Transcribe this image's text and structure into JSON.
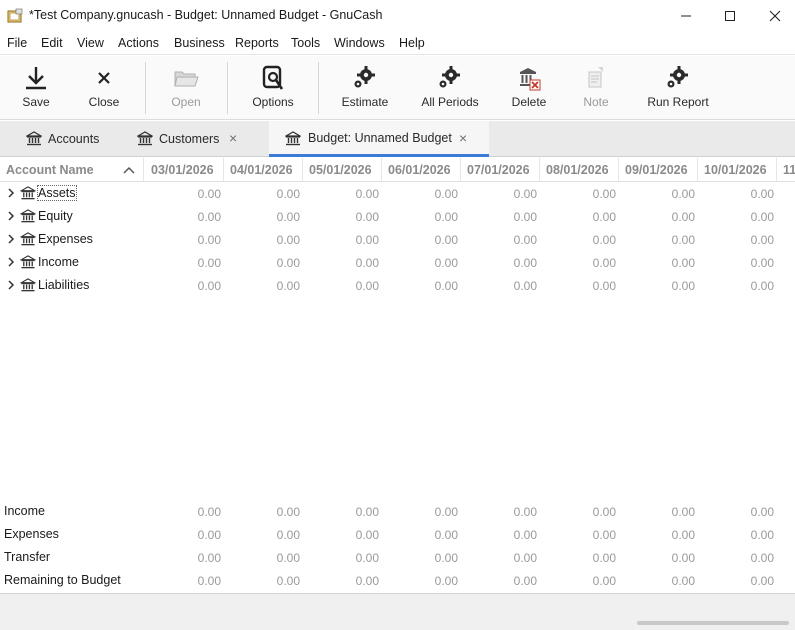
{
  "window": {
    "title": "*Test Company.gnucash - Budget: Unnamed Budget - GnuCash"
  },
  "menu": [
    "File",
    "Edit",
    "View",
    "Actions",
    "Business",
    "Reports",
    "Tools",
    "Windows",
    "Help"
  ],
  "toolbar": {
    "save": "Save",
    "close": "Close",
    "open": "Open",
    "options": "Options",
    "estimate": "Estimate",
    "all_periods": "All Periods",
    "delete": "Delete",
    "note": "Note",
    "run_report": "Run Report"
  },
  "tabs": {
    "accounts": "Accounts",
    "customers": "Customers",
    "budget": "Budget: Unnamed Budget",
    "close_glyph": "×"
  },
  "table": {
    "name_header": "Account Name",
    "periods": [
      "03/01/2026",
      "04/01/2026",
      "05/01/2026",
      "06/01/2026",
      "07/01/2026",
      "08/01/2026",
      "09/01/2026",
      "10/01/2026",
      "11"
    ],
    "accounts": [
      {
        "name": "Assets",
        "values": [
          "0.00",
          "0.00",
          "0.00",
          "0.00",
          "0.00",
          "0.00",
          "0.00",
          "0.00"
        ]
      },
      {
        "name": "Equity",
        "values": [
          "0.00",
          "0.00",
          "0.00",
          "0.00",
          "0.00",
          "0.00",
          "0.00",
          "0.00"
        ]
      },
      {
        "name": "Expenses",
        "values": [
          "0.00",
          "0.00",
          "0.00",
          "0.00",
          "0.00",
          "0.00",
          "0.00",
          "0.00"
        ]
      },
      {
        "name": "Income",
        "values": [
          "0.00",
          "0.00",
          "0.00",
          "0.00",
          "0.00",
          "0.00",
          "0.00",
          "0.00"
        ]
      },
      {
        "name": "Liabilities",
        "values": [
          "0.00",
          "0.00",
          "0.00",
          "0.00",
          "0.00",
          "0.00",
          "0.00",
          "0.00"
        ]
      }
    ],
    "totals": [
      {
        "label": "Income",
        "values": [
          "0.00",
          "0.00",
          "0.00",
          "0.00",
          "0.00",
          "0.00",
          "0.00",
          "0.00"
        ]
      },
      {
        "label": "Expenses",
        "values": [
          "0.00",
          "0.00",
          "0.00",
          "0.00",
          "0.00",
          "0.00",
          "0.00",
          "0.00"
        ]
      },
      {
        "label": "Transfer",
        "values": [
          "0.00",
          "0.00",
          "0.00",
          "0.00",
          "0.00",
          "0.00",
          "0.00",
          "0.00"
        ]
      },
      {
        "label": "Remaining to Budget",
        "values": [
          "0.00",
          "0.00",
          "0.00",
          "0.00",
          "0.00",
          "0.00",
          "0.00",
          "0.00"
        ]
      }
    ]
  },
  "colors": {
    "accent": "#3a7bd5",
    "header_text": "#8a8a8a",
    "value_text": "#9a9a9a"
  },
  "icons": {
    "app": "gnucash-app-icon",
    "account": "bank-icon",
    "expander": "chevron-right-icon"
  }
}
